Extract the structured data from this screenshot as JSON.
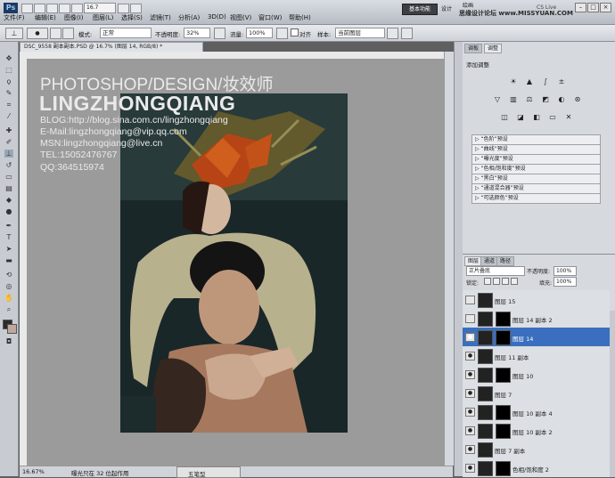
{
  "app": {
    "logo": "Ps",
    "zoom": "16.7",
    "workspace": "基本功能",
    "workspace_links": [
      "设计",
      "绘画"
    ],
    "cs_live": "CS Live",
    "watermark": "思缘设计论坛 www.MISSYUAN.COM"
  },
  "menu": [
    "文件(F)",
    "编辑(E)",
    "图像(I)",
    "图层(L)",
    "选择(S)",
    "滤镜(T)",
    "分析(A)",
    "3D(D)",
    "视图(V)",
    "窗口(W)",
    "帮助(H)"
  ],
  "options": {
    "mode_label": "模式:",
    "mode_value": "正常",
    "opacity_label": "不透明度:",
    "opacity_value": "32%",
    "flow_label": "流量:",
    "flow_value": "100%",
    "align_label": "对齐",
    "sample_label": "样本:",
    "sample_value": "当前图层"
  },
  "document": {
    "tab": "DSC_9558 副本副本.PSD @ 16.7% (图层 14, RGB/8) *",
    "status_zoom": "16.67%",
    "status_info": "曝光只在 32 位起作用",
    "status_mode": "五笔型"
  },
  "photo_text": {
    "line1": "PHOTOSHOP/DESIGN/妆效师",
    "line2": "LINGZHONGQIANG",
    "blog": "BLOG:http://blog.sina.com.cn/lingzhongqiang",
    "email": "E-Mail:lingzhongqiang@vip.qq.com",
    "msn": "MSN:lingzhongqiang@live.cn",
    "tel": "TEL:15052476767",
    "qq": "QQ:364515974"
  },
  "adjustments": {
    "tabs": [
      "调板",
      "调整"
    ],
    "title": "添加调整",
    "presets": [
      "“色阶”预设",
      "“曲线”预设",
      "“曝光度”预设",
      "“色相/饱和度”预设",
      "“黑白”预设",
      "“通道混合器”预设",
      "“可选颜色”预设"
    ]
  },
  "layers": {
    "tabs": [
      "图层",
      "通道",
      "路径"
    ],
    "blend_mode": "正片叠底",
    "opacity_label": "不透明度:",
    "opacity_value": "100%",
    "lock_label": "锁定:",
    "fill_label": "填充:",
    "fill_value": "100%",
    "items": [
      {
        "name": "图层 15",
        "visible": false,
        "mask": false
      },
      {
        "name": "图层 14 副本 2",
        "visible": false,
        "mask": true
      },
      {
        "name": "图层 14",
        "visible": true,
        "mask": true,
        "selected": true
      },
      {
        "name": "图层 11 副本",
        "visible": true,
        "mask": false
      },
      {
        "name": "图层 10",
        "visible": true,
        "mask": true
      },
      {
        "name": "图层 7",
        "visible": true,
        "mask": false
      },
      {
        "name": "图层 10 副本 4",
        "visible": true,
        "mask": true
      },
      {
        "name": "图层 10 副本 2",
        "visible": true,
        "mask": true
      },
      {
        "name": "图层 7 副本",
        "visible": true,
        "mask": false
      },
      {
        "name": "色相/饱和度 2",
        "visible": true,
        "mask": true
      }
    ]
  }
}
